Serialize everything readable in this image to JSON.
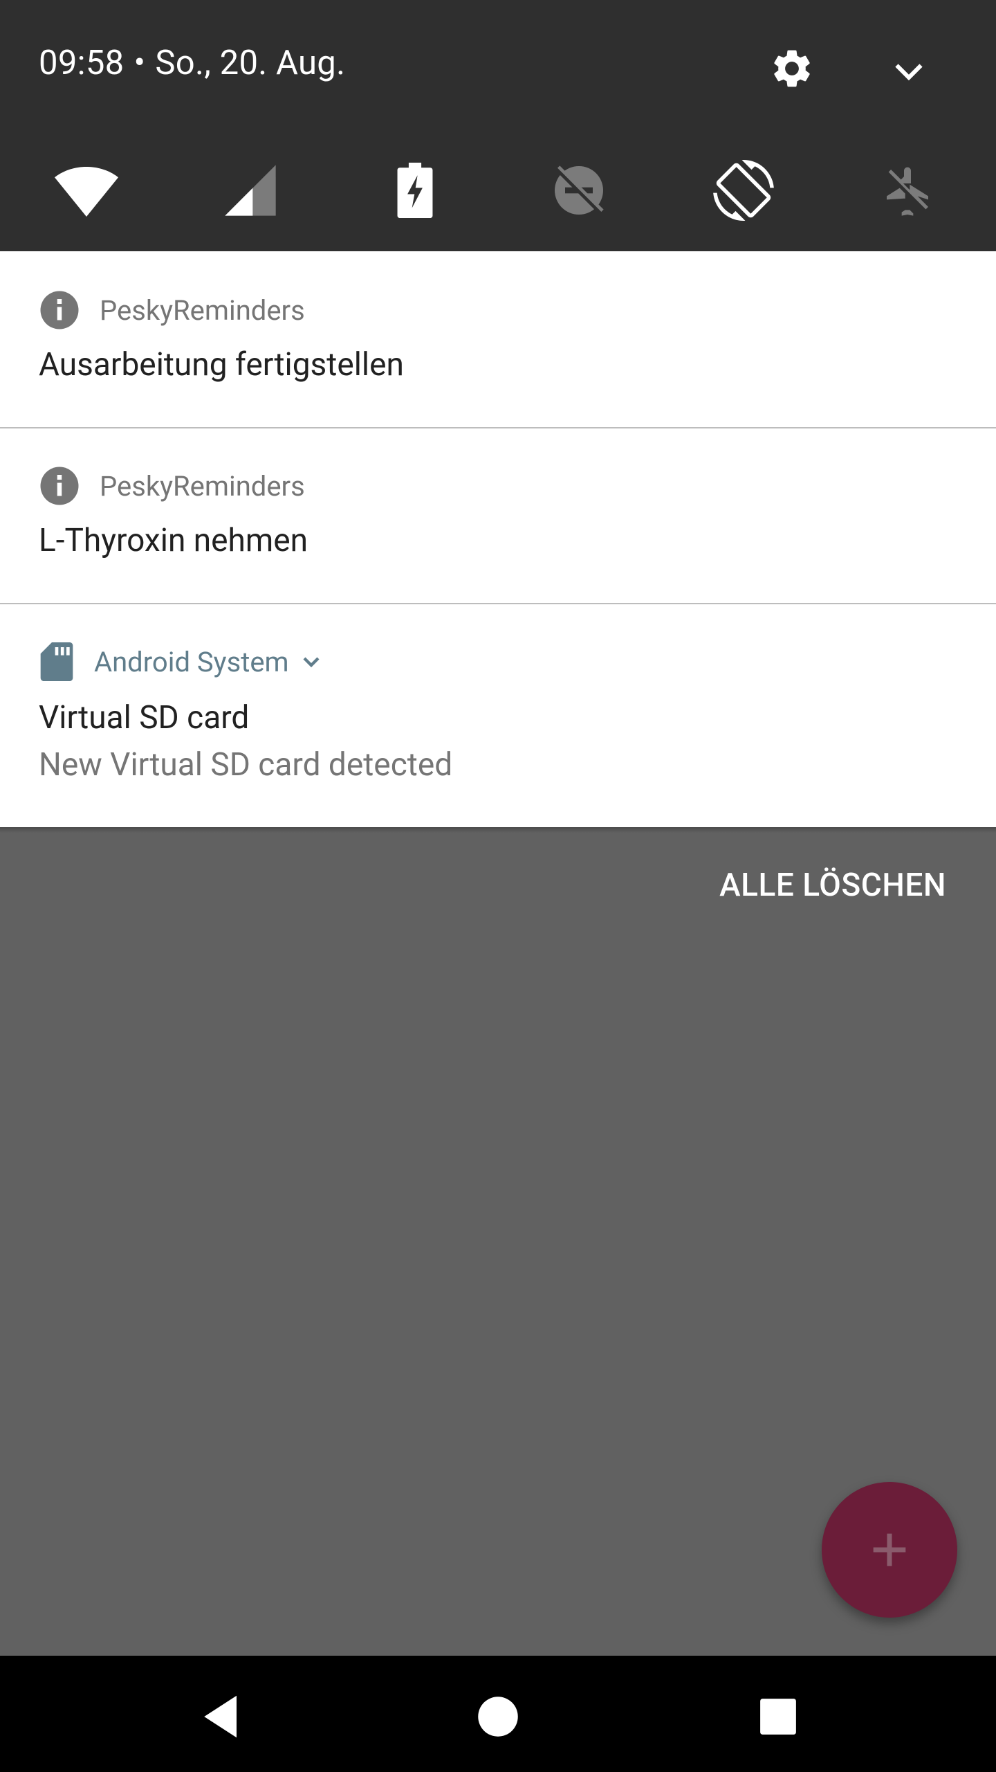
{
  "status": {
    "time": "09:58",
    "separator": "•",
    "date": "So., 20. Aug."
  },
  "header_icons": [
    "settings-icon",
    "expand-chevron-icon"
  ],
  "quick_tiles": [
    "wifi-icon",
    "cell-signal-icon",
    "battery-charging-icon",
    "do-not-disturb-off-icon",
    "auto-rotate-icon",
    "airplane-mode-icon"
  ],
  "notifications": [
    {
      "app": "PeskyReminders",
      "icon": "info-icon",
      "title": "Ausarbeitung fertigstellen"
    },
    {
      "app": "PeskyReminders",
      "icon": "info-icon",
      "title": "L-Thyroxin nehmen"
    },
    {
      "app": "Android System",
      "icon": "sd-card-icon",
      "title": "Virtual SD card",
      "text": "New Virtual SD card detected"
    }
  ],
  "actions": {
    "clear_all": "ALLE LÖSCHEN",
    "fab_icon": "plus-icon"
  },
  "colors": {
    "qs_background": "#2f2f2f",
    "scrim": "#616161",
    "fab": "#6b1d39",
    "android_system_accent": "#607d8b"
  },
  "nav": [
    "back-icon",
    "home-icon",
    "recents-icon"
  ]
}
